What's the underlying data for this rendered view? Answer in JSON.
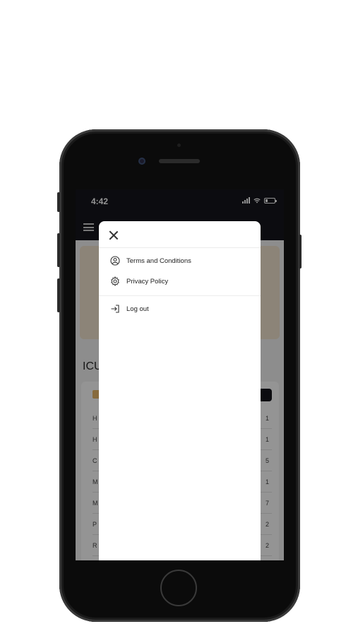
{
  "status": {
    "time": "4:42"
  },
  "background": {
    "section_title": "ICU",
    "rows": [
      {
        "label": "H",
        "value": "1"
      },
      {
        "label": "H",
        "value": "1"
      },
      {
        "label": "C",
        "value": "5"
      },
      {
        "label": "M",
        "value": "1"
      },
      {
        "label": "M",
        "value": "7"
      },
      {
        "label": "P",
        "value": "2"
      },
      {
        "label": "R",
        "value": "2"
      }
    ]
  },
  "drawer": {
    "items": [
      {
        "label": "Terms and Conditions",
        "icon": "account-circle-icon"
      },
      {
        "label": "Privacy Policy",
        "icon": "gear-icon"
      }
    ],
    "logout": {
      "label": "Log out",
      "icon": "logout-icon"
    }
  },
  "colors": {
    "appbar": "#16161d",
    "banner": "#f1e3cf",
    "accent": "#e8b96b"
  }
}
